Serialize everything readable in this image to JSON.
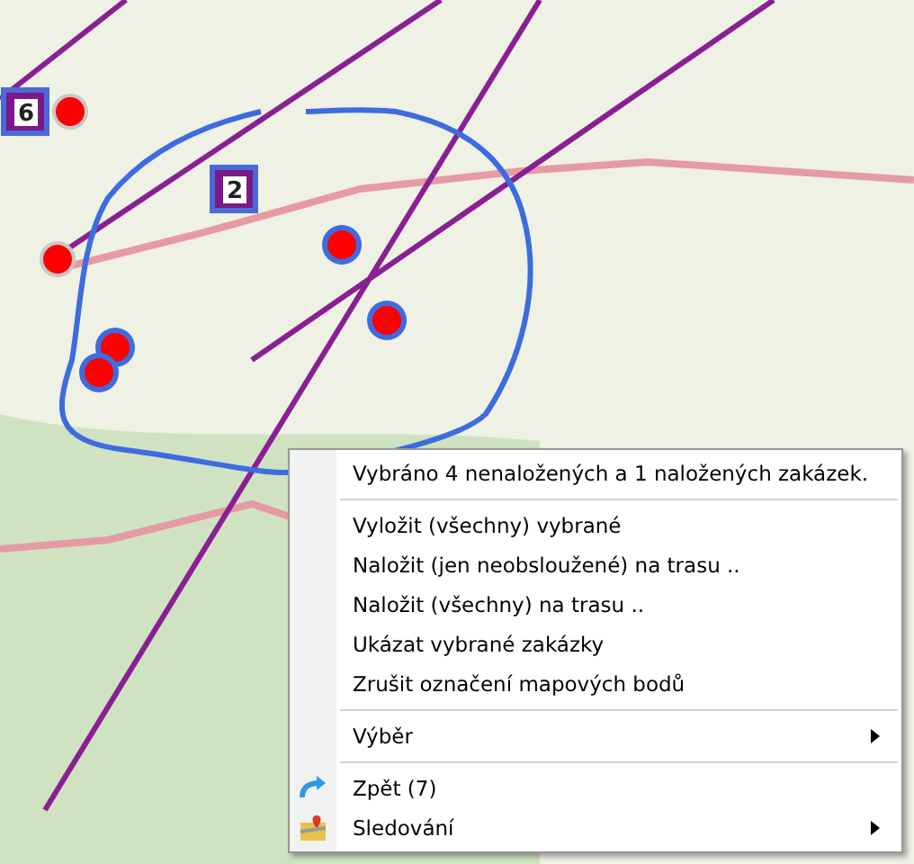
{
  "map": {
    "route_stops": [
      {
        "label": "6"
      },
      {
        "label": "2"
      }
    ],
    "markers": [
      {
        "selected": false
      },
      {
        "selected": false
      },
      {
        "selected": true
      },
      {
        "selected": true
      },
      {
        "selected": true
      },
      {
        "selected": true
      }
    ]
  },
  "context_menu": {
    "items": [
      {
        "kind": "header",
        "label": "Vybráno 4 nenaložených a 1 naložených zakázek."
      },
      {
        "kind": "separator"
      },
      {
        "kind": "item",
        "label": "Vyložit (všechny) vybrané"
      },
      {
        "kind": "item",
        "label": "Naložit (jen neobsloužené) na trasu .."
      },
      {
        "kind": "item",
        "label": "Naložit (všechny) na trasu .."
      },
      {
        "kind": "item",
        "label": "Ukázat vybrané zakázky"
      },
      {
        "kind": "item",
        "label": "Zrušit označení mapových bodů"
      },
      {
        "kind": "separator"
      },
      {
        "kind": "submenu",
        "label": "Výběr"
      },
      {
        "kind": "separator"
      },
      {
        "kind": "undo",
        "label": "Zpět (7)"
      },
      {
        "kind": "tracking",
        "label": "Sledování"
      }
    ]
  }
}
